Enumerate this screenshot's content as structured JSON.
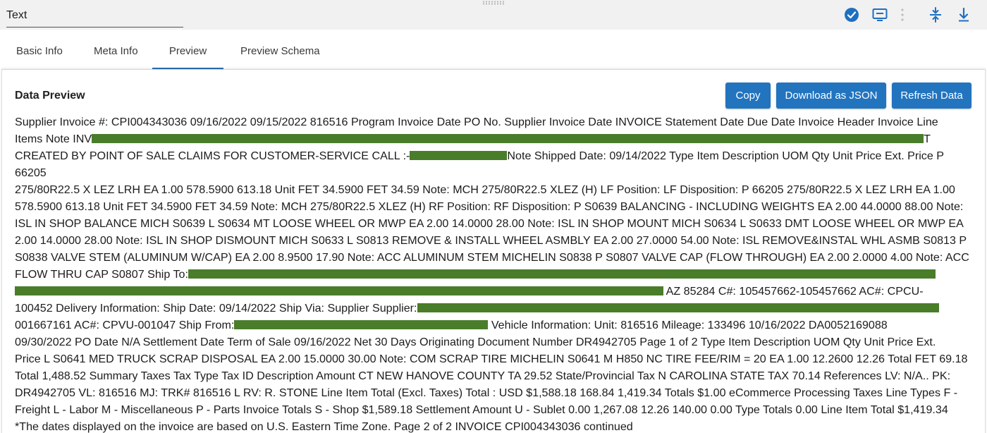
{
  "header": {
    "title_value": "Text",
    "icons": [
      "check-circle-icon",
      "monitor-icon",
      "more-vertical-icon",
      "collapse-vertical-icon",
      "download-icon"
    ]
  },
  "tabs": [
    {
      "label": "Basic Info",
      "active": false
    },
    {
      "label": "Meta Info",
      "active": false
    },
    {
      "label": "Preview",
      "active": true
    },
    {
      "label": "Preview Schema",
      "active": false
    }
  ],
  "panel": {
    "title": "Data Preview",
    "buttons": {
      "copy": "Copy",
      "download_json": "Download as JSON",
      "refresh": "Refresh Data"
    }
  },
  "preview": {
    "l1": "Supplier Invoice #: CPI004343036 09/16/2022 09/15/2022 816516 Program Invoice Date PO No. Supplier Invoice Date INVOICE Statement Date Due Date Invoice Header Invoice Line",
    "l2": "Items Note INV",
    "l2b": "T",
    "l3a": "CREATED BY POINT OF SALE CLAIMS FOR CUSTOMER-SERVICE CALL :-",
    "l3b": "Note Shipped Date: 09/14/2022 Type Item Description UOM Qty Unit Price Ext. Price P 66205",
    "l4": "275/80R22.5 X LEZ LRH EA 1.00 578.5900 613.18 Unit FET 34.5900 FET 34.59 Note: MCH 275/80R22.5 XLEZ (H) LF Position: LF Disposition: P 66205 275/80R22.5 X LEZ LRH EA 1.00",
    "l5": "578.5900 613.18 Unit FET 34.5900 FET 34.59 Note: MCH 275/80R22.5 XLEZ (H) RF Position: RF Disposition: P S0639 BALANCING - INCLUDING WEIGHTS EA 2.00 44.0000 88.00 Note:",
    "l6": "ISL IN SHOP BALANCE MICH S0639 L S0634 MT LOOSE WHEEL OR MWP EA 2.00 14.0000 28.00 Note: ISL IN SHOP MOUNT MICH S0634 L S0633 DMT LOOSE WHEEL OR MWP EA",
    "l7": "2.00 14.0000 28.00 Note: ISL IN SHOP DISMOUNT MICH S0633 L S0813 REMOVE & INSTALL WHEEL ASMBLY EA 2.00 27.0000 54.00 Note: ISL REMOVE&INSTAL WHL ASMB S0813 P",
    "l8": "S0838 VALVE STEM (ALUMINUM W/CAP) EA 2.00 8.9500 17.90 Note: ACC ALUMINUM STEM MICHELIN S0838 P S0807 VALVE CAP (FLOW THROUGH) EA 2.00 2.0000 4.00 Note: ACC",
    "l9": "FLOW THRU CAP S0807 Ship To:",
    "l10": "AZ 85284 C#: 105457662-105457662 AC#: CPCU-",
    "l11": "100452 Delivery Information: Ship Date: 09/14/2022 Ship Via: Supplier Supplier:",
    "l12a": "001667161 AC#: CPVU-001047 Ship From:",
    "l12b": "Vehicle Information: Unit: 816516 Mileage: 133496 10/16/2022 DA0052169088",
    "l13": "09/30/2022 PO Date N/A Settlement Date Term of Sale 09/16/2022 Net 30 Days Originating Document Number DR4942705 Page 1 of 2 Type Item Description UOM Qty Unit Price Ext.",
    "l14": "Price L S0641 MED TRUCK SCRAP DISPOSAL EA 2.00 15.0000 30.00 Note: COM SCRAP TIRE MICHELIN S0641 M H850 NC TIRE FEE/RIM = 20 EA 1.00 12.2600 12.26 Total FET 69.18",
    "l15": "Total 1,488.52 Summary Taxes Tax Type Tax ID Description Amount CT NEW HANOVE COUNTY TA 29.52 State/Provincial Tax N CAROLINA STATE TAX 70.14 References LV: N/A.. PK:",
    "l16": "DR4942705 VL: 816516 MJ: TRK# 816516 L RV: R. STONE Line Item Total (Excl. Taxes) Total : USD $1,588.18 168.84 1,419.34 Totals $1.00 eCommerce Processing Taxes Line Types F -",
    "l17": "Freight L - Labor M - Miscellaneous P - Parts Invoice Totals S - Shop $1,589.18 Settlement Amount U - Sublet 0.00 1,267.08 12.26 140.00 0.00 Type Totals 0.00 Line Item Total $1,419.34",
    "l18": "*The dates displayed on the invoice are based on U.S. Eastern Time Zone. Page 2 of 2 INVOICE CPI004343036 continued"
  },
  "colors": {
    "accent": "#2274bf",
    "redaction": "#4a7d2a",
    "topbar_bg": "#f1f1f1"
  }
}
